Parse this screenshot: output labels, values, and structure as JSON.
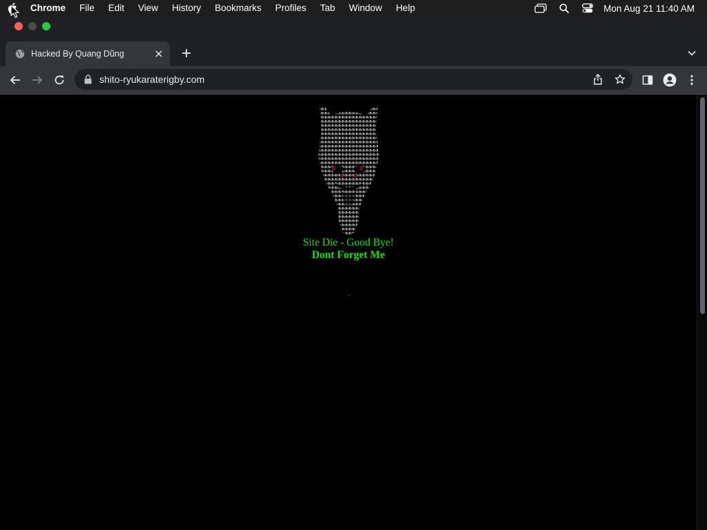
{
  "menubar": {
    "app": "Chrome",
    "items": [
      "File",
      "Edit",
      "View",
      "History",
      "Bookmarks",
      "Profiles",
      "Tab",
      "Window",
      "Help"
    ],
    "clock": "Mon Aug 21  11:40 AM"
  },
  "tab": {
    "title": "Hacked By Quang Dũng"
  },
  "omnibox": {
    "url": "shito-ryukaraterigby.com"
  },
  "page": {
    "line1": "Site Die - Good Bye!",
    "line2": "Dont Forget Me"
  },
  "icons": {
    "traffic_red": "#ff5f57",
    "traffic_yellow": "#4d4d4d",
    "traffic_green": "#28c840",
    "message_color": "#14e314"
  }
}
